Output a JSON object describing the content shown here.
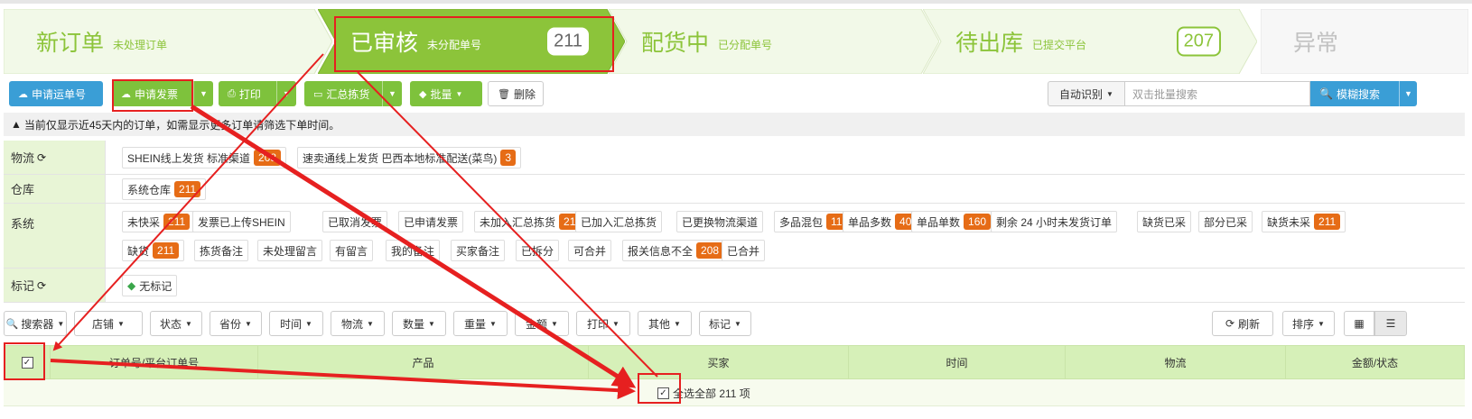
{
  "steps": [
    {
      "title": "新订单",
      "sub": "未处理订单",
      "count": "",
      "state": "normal"
    },
    {
      "title": "已审核",
      "sub": "未分配单号",
      "count": "211",
      "state": "active"
    },
    {
      "title": "配货中",
      "sub": "已分配单号",
      "count": "",
      "state": "normal"
    },
    {
      "title": "待出库",
      "sub": "已提交平台",
      "count": "207",
      "state": "plain"
    },
    {
      "title": "异常",
      "sub": "",
      "count": "",
      "state": "disabled"
    }
  ],
  "toolbar": {
    "apply_tracking": "申请运单号",
    "apply_invoice": "申请发票",
    "print": "打印",
    "pick_summary": "汇总拣货",
    "batch": "批量",
    "delete": "删除",
    "auto_detect": "自动识别",
    "search_placeholder": "双击批量搜索",
    "fuzzy_search": "模糊搜索"
  },
  "notice": "当前仅显示近45天内的订单，如需显示更多订单请筛选下单时间。",
  "filters": {
    "logistics": {
      "label": "物流",
      "items": [
        {
          "text": "SHEIN线上发货 标准渠道",
          "count": "208"
        },
        {
          "text": "速卖通线上发货 巴西本地标准配送(菜鸟)",
          "count": "3"
        }
      ]
    },
    "warehouse": {
      "label": "仓库",
      "items": [
        {
          "text": "系统仓库",
          "count": "211"
        }
      ]
    },
    "system": {
      "label": "系统",
      "items": [
        {
          "text": "未快采",
          "count": "211"
        },
        {
          "text": "发票已上传SHEIN",
          "count": ""
        },
        {
          "text": "已取消发票",
          "count": ""
        },
        {
          "text": "已申请发票",
          "count": ""
        },
        {
          "text": "未加入汇总拣货",
          "count": "211"
        },
        {
          "text": "已加入汇总拣货",
          "count": ""
        },
        {
          "text": "已更换物流渠道",
          "count": ""
        },
        {
          "text": "多品混包",
          "count": "11"
        },
        {
          "text": "单品多数",
          "count": "40"
        },
        {
          "text": "单品单数",
          "count": "160"
        },
        {
          "text": "剩余 24 小时未发货订单",
          "count": ""
        },
        {
          "text": "缺货已采",
          "count": ""
        },
        {
          "text": "部分已采",
          "count": ""
        },
        {
          "text": "缺货未采",
          "count": "211"
        },
        {
          "text": "缺货",
          "count": "211"
        },
        {
          "text": "拣货备注",
          "count": ""
        },
        {
          "text": "未处理留言",
          "count": ""
        },
        {
          "text": "有留言",
          "count": ""
        },
        {
          "text": "我的备注",
          "count": ""
        },
        {
          "text": "买家备注",
          "count": ""
        },
        {
          "text": "已拆分",
          "count": ""
        },
        {
          "text": "可合并",
          "count": ""
        },
        {
          "text": "报关信息不全",
          "count": "208"
        },
        {
          "text": "已合并",
          "count": ""
        }
      ]
    },
    "mark": {
      "label": "标记",
      "items": [
        {
          "text": "无标记",
          "count": ""
        }
      ]
    }
  },
  "dropdowns": [
    "搜索器",
    "店铺",
    "状态",
    "省份",
    "时间",
    "物流",
    "数量",
    "重量",
    "金额",
    "打印",
    "其他",
    "标记"
  ],
  "right_controls": {
    "refresh": "刷新",
    "sort": "排序"
  },
  "table": {
    "headers": [
      "订单号/平台订单号",
      "产品",
      "买家",
      "时间",
      "物流",
      "金额/状态"
    ],
    "select_all": "全选全部 211 项"
  },
  "colors": {
    "accent_green": "#8cc43a",
    "blue": "#3a9ed6",
    "badge_orange": "#e66c16",
    "annotation_red": "#e62020"
  }
}
